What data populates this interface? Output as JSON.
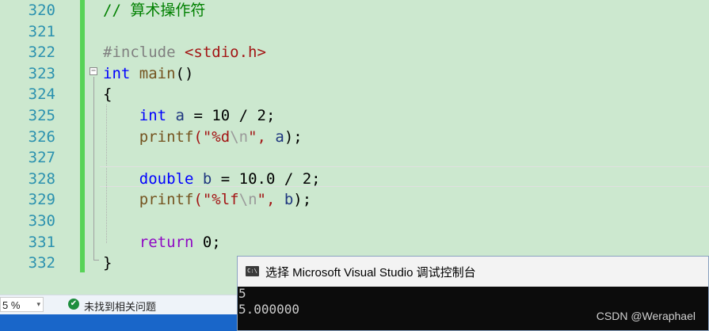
{
  "editor": {
    "line_numbers": [
      "320",
      "321",
      "322",
      "323",
      "324",
      "325",
      "326",
      "327",
      "328",
      "329",
      "330",
      "331",
      "332"
    ],
    "fold_marker": "−",
    "code": {
      "l320": "// 算术操作符",
      "l322_directive": "#include",
      "l322_header": "<stdio.h>",
      "l323_type": "int",
      "l323_name": "main",
      "l323_parens": "()",
      "l324": "{",
      "l325_type": "int",
      "l325_var": "a",
      "l325_rest": " = 10 / 2;",
      "l326_fn": "printf",
      "l326_open": "(\"",
      "l326_fmt": "%d",
      "l326_esc": "\\n",
      "l326_close": "\", ",
      "l326_arg": "a",
      "l326_end": ");",
      "l328_type": "double",
      "l328_var": "b",
      "l328_rest": " = 10.0 / 2;",
      "l329_fn": "printf",
      "l329_open": "(\"",
      "l329_fmt": "%lf",
      "l329_esc": "\\n",
      "l329_close": "\", ",
      "l329_arg": "b",
      "l329_end": ");",
      "l331_kw": "return",
      "l331_rest": " 0;",
      "l332": "}"
    }
  },
  "status_bar": {
    "zoom_value": "5 %",
    "zoom_caret": "▾",
    "check_glyph": "✔",
    "issues_text": "未找到相关问题"
  },
  "console": {
    "icon_text": "C:\\",
    "title": "选择 Microsoft Visual Studio 调试控制台",
    "output": [
      "5",
      "5.000000"
    ],
    "watermark": "CSDN @Weraphael"
  },
  "colors": {
    "editor_bg": "#cce8cf",
    "comment": "#008000",
    "keyword": "#0000ff",
    "control_keyword": "#8f08c4",
    "string": "#a31515",
    "line_number": "#2b91af",
    "change_bar": "#57d357"
  }
}
